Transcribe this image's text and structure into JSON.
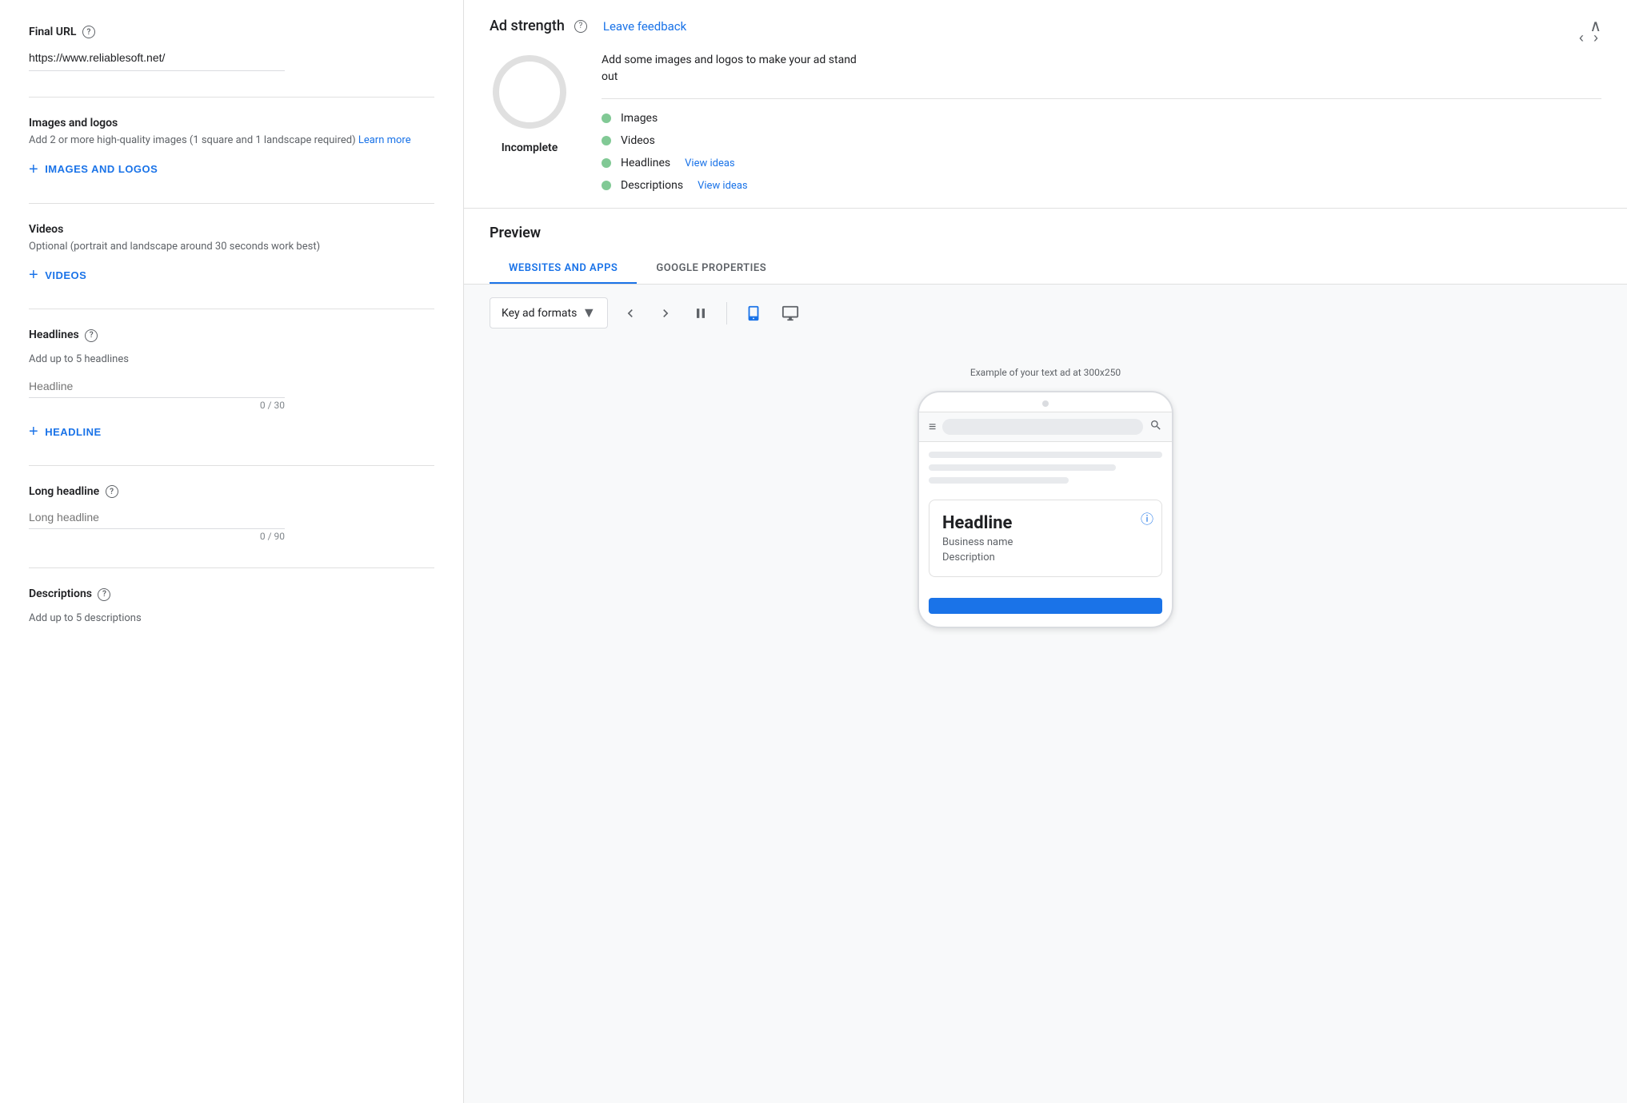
{
  "left": {
    "final_url": {
      "label": "Final URL",
      "value": "https://www.reliablesoft.net/"
    },
    "images_logos": {
      "label": "Images and logos",
      "desc": "Add 2 or more high-quality images (1 square and 1 landscape required)",
      "learn_more": "Learn more",
      "add_button": "IMAGES AND LOGOS"
    },
    "videos": {
      "label": "Videos",
      "desc": "Optional (portrait and landscape around 30 seconds work best)",
      "add_button": "VIDEOS"
    },
    "headlines": {
      "label": "Headlines",
      "desc": "Add up to 5 headlines",
      "placeholder": "Headline",
      "char_count": "0 / 30",
      "add_button": "HEADLINE"
    },
    "long_headline": {
      "label": "Long headline",
      "placeholder": "Long headline",
      "char_count": "0 / 90"
    },
    "descriptions": {
      "label": "Descriptions",
      "desc": "Add up to 5 descriptions"
    }
  },
  "right": {
    "ad_strength": {
      "title": "Ad strength",
      "leave_feedback": "Leave feedback",
      "status": "Incomplete",
      "tip": "Add some images and logos to make your ad stand out",
      "items": [
        {
          "label": "Images"
        },
        {
          "label": "Videos"
        },
        {
          "label": "Headlines",
          "view_ideas": "View ideas"
        },
        {
          "label": "Descriptions",
          "view_ideas": "View ideas"
        }
      ]
    },
    "preview": {
      "title": "Preview",
      "tabs": [
        {
          "label": "WEBSITES AND APPS",
          "active": true
        },
        {
          "label": "GOOGLE PROPERTIES",
          "active": false
        }
      ],
      "toolbar": {
        "format_label": "Key ad formats",
        "dropdown_icon": "▼"
      },
      "ad_example_label": "Example of your text ad at 300x250",
      "ad": {
        "headline": "Headline",
        "business_name": "Business name",
        "description": "Description"
      },
      "device_mobile": "mobile",
      "device_desktop": "desktop"
    }
  },
  "icons": {
    "help": "?",
    "plus": "+",
    "collapse": "∧",
    "arrow_left": "‹",
    "arrow_right": "›",
    "pause": "⏸",
    "mobile": "📱",
    "desktop": "🖥",
    "menu": "≡",
    "search": "🔍",
    "info": "ⓘ",
    "chevron_down": "▾"
  }
}
